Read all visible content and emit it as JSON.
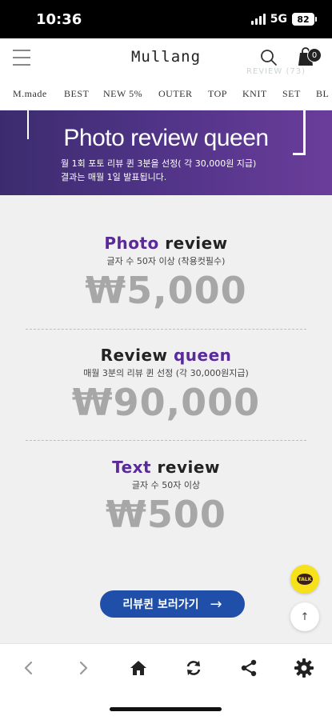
{
  "status": {
    "time": "10:36",
    "network": "5G",
    "battery": "82"
  },
  "header": {
    "logo": "Mullang",
    "cart_count": "0",
    "ghost_text": "REVIEW (73)"
  },
  "nav": {
    "items": [
      "M.made",
      "BEST",
      "NEW 5%",
      "OUTER",
      "TOP",
      "KNIT",
      "SET",
      "BL"
    ]
  },
  "banner": {
    "title": "Photo review queen",
    "line1": "월 1회 포토 리뷰 퀸 3분을 선정( 각 30,000원 지급)",
    "line2": "결과는 매월 1일 발표됩니다."
  },
  "sections": [
    {
      "title_a": "Photo",
      "title_b": " review",
      "desc": "글자 수 50자 이상 (착용컷필수)",
      "amount": "₩5,000"
    },
    {
      "title_a": "Review ",
      "title_b": "queen",
      "desc": "매월 3분의 리뷰 퀸 선정 (각 30,000원지급)",
      "amount": "₩90,000"
    },
    {
      "title_a": "Text",
      "title_b": " review",
      "desc": "글자 수 50자 이상",
      "amount": "₩500"
    }
  ],
  "cta": {
    "label": "리뷰퀸 보러가기",
    "arrow": "→"
  },
  "floating": {
    "kakao_label": "TALK",
    "top_label": "↑"
  },
  "colors": {
    "banner_purple": "#4f3386",
    "accent_purple": "#5a2a9a",
    "cta_blue": "#1f4fa8",
    "amount_gray": "#a7a7a7",
    "kakao_yellow": "#f7e11a"
  },
  "toolbar_icons": [
    "back-icon",
    "forward-icon",
    "home-icon",
    "refresh-icon",
    "share-icon",
    "settings-icon"
  ]
}
